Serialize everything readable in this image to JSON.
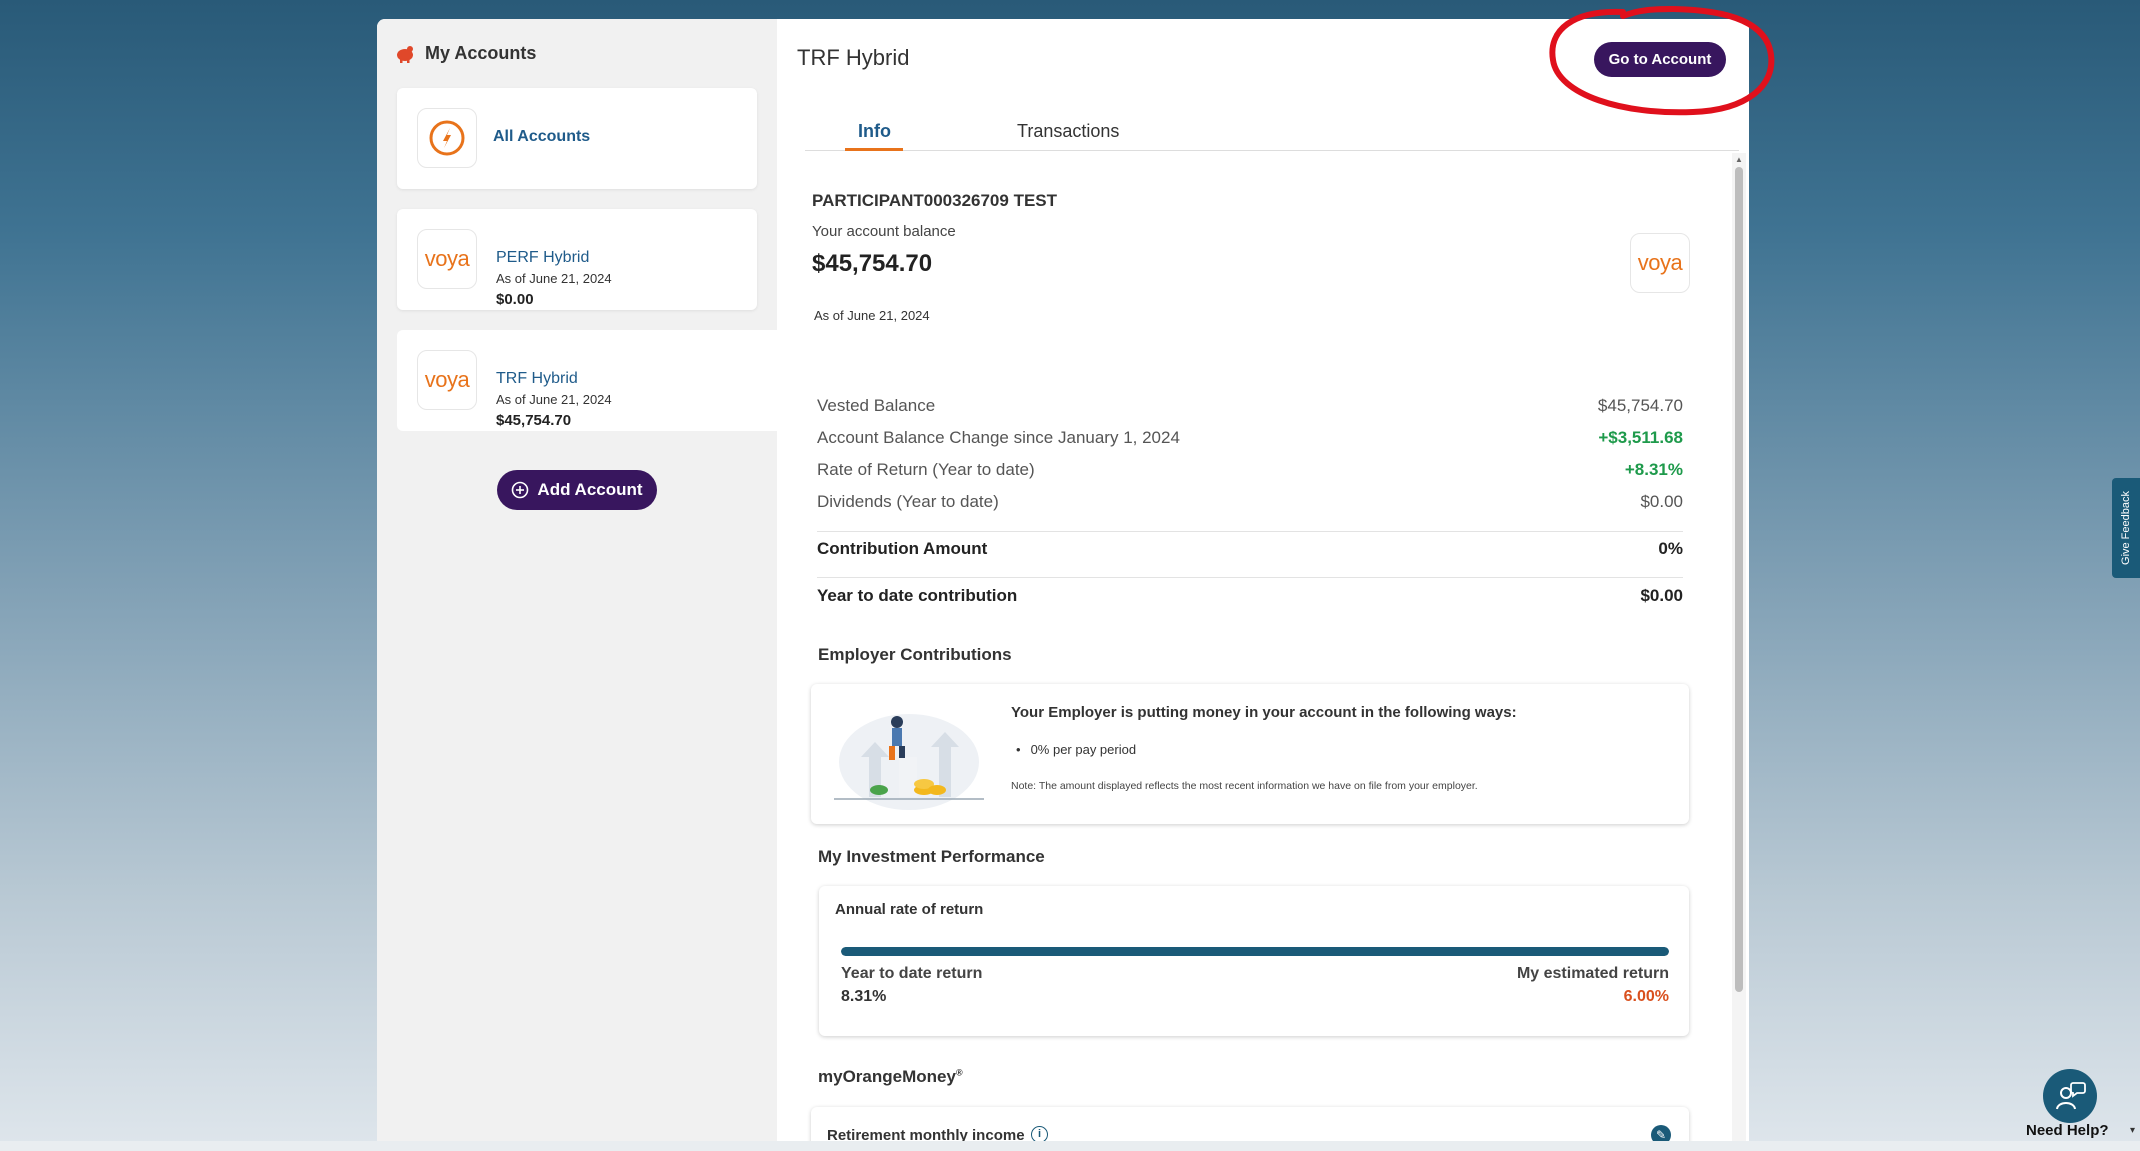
{
  "sidebar": {
    "title": "My Accounts",
    "all_accounts": "All Accounts",
    "accounts": [
      {
        "name": "PERF Hybrid",
        "as_of": "As of June 21, 2024",
        "amount": "$0.00",
        "logo": "voya"
      },
      {
        "name": "TRF Hybrid",
        "as_of": "As of June 21, 2024",
        "amount": "$45,754.70",
        "logo": "voya"
      }
    ],
    "add_account": "Add Account"
  },
  "main": {
    "title": "TRF Hybrid",
    "go_to_account": "Go to Account",
    "tabs": [
      "Info",
      "Transactions"
    ],
    "participant": "PARTICIPANT000326709 TEST",
    "balance_label": "Your account balance",
    "balance": "$45,754.70",
    "balance_as_of": "As of June 21, 2024",
    "logo_text": "voya",
    "rows": [
      {
        "label": "Vested Balance",
        "value": "$45,754.70"
      },
      {
        "label": "Account Balance Change since January 1, 2024",
        "value": "+$3,511.68"
      },
      {
        "label": "Rate of Return (Year to date)",
        "value": "+8.31%"
      },
      {
        "label": "Dividends (Year to date)",
        "value": "$0.00"
      }
    ],
    "contribution_amount_label": "Contribution Amount",
    "contribution_amount_value": "0%",
    "ytd_contribution_label": "Year to date contribution",
    "ytd_contribution_value": "$0.00",
    "employer": {
      "heading": "Employer Contributions",
      "title": "Your Employer is putting money in your account in the following ways:",
      "bullet": "0% per pay period",
      "note": "Note: The amount displayed reflects the most recent information we have on file from your employer."
    },
    "performance": {
      "heading": "My Investment Performance",
      "card_title": "Annual rate of return",
      "ytd_label": "Year to date return",
      "ytd_value": "8.31%",
      "est_label": "My estimated return",
      "est_value": "6.00%",
      "bar_fill_fraction": 1.0
    },
    "orange_money": {
      "heading": "myOrangeMoney",
      "heading_mark": "®",
      "card_label": "Retirement monthly income"
    }
  },
  "side_widgets": {
    "feedback": "Give Feedback",
    "help": "Need Help?"
  },
  "colors": {
    "accent_purple": "#38165e",
    "brand_orange": "#e8731b",
    "teal": "#1a5a78",
    "positive_green": "#1e9a4b",
    "estimate_orange": "#d9501e",
    "annotation_red": "#e0101c"
  }
}
